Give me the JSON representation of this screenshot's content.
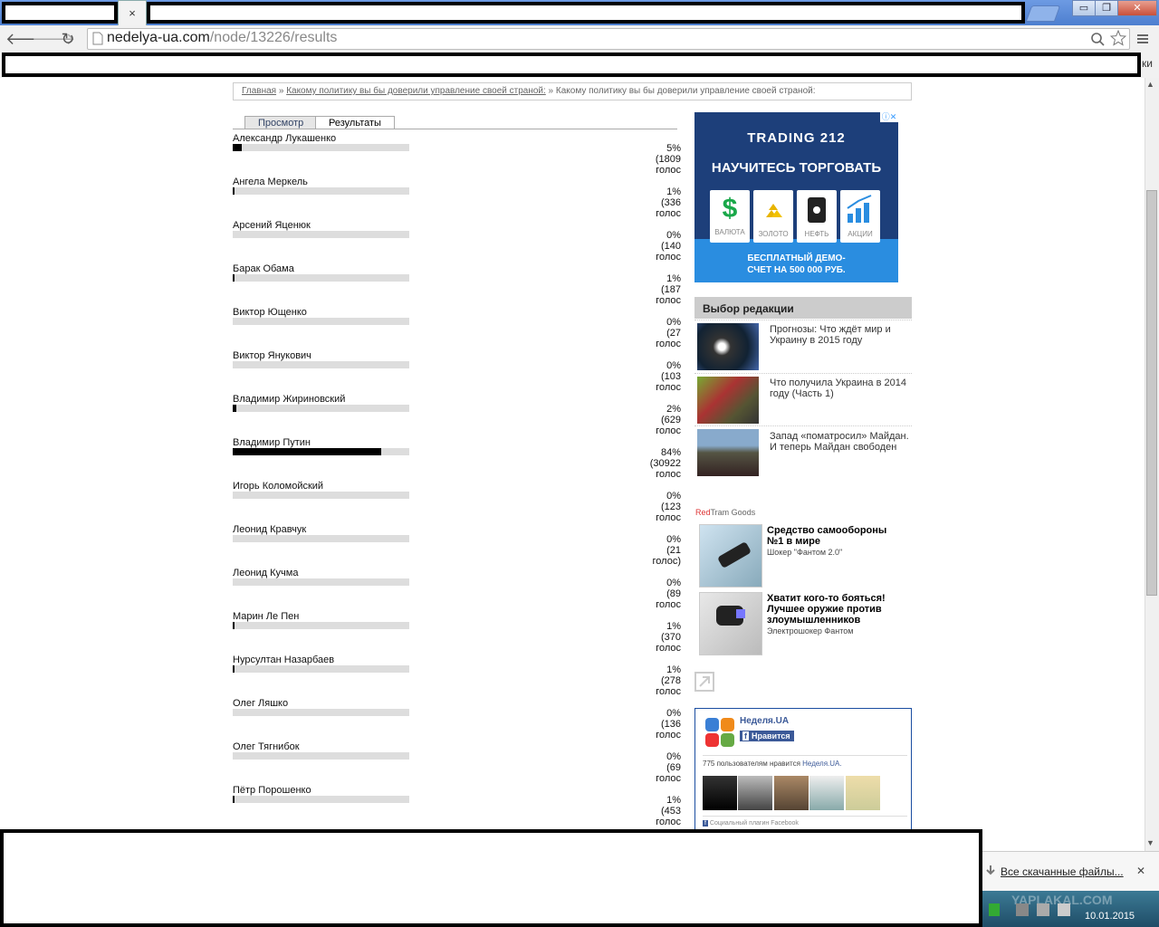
{
  "browser": {
    "tab_close_glyph": "×",
    "url_host": "nedelya-ua.com",
    "url_path": "/node/13226/results",
    "bookmarks_tail": "ки",
    "win_min": "▭",
    "win_restore": "❐",
    "win_close": "✕"
  },
  "breadcrumb": {
    "home": "Главная",
    "sep1": " » ",
    "parent": "Какому политику вы бы доверили управление своей страной:",
    "sep2": " » ",
    "current": "Какому политику вы бы доверили управление своей страной:"
  },
  "poll": {
    "tab_view": "Просмотр",
    "tab_results": "Результаты",
    "results": [
      {
        "name": "Александр Лукашенко",
        "pct": "5%",
        "votes": "(1809",
        "word": "голос",
        "share": 0.05
      },
      {
        "name": "Ангела Меркель",
        "pct": "1%",
        "votes": "(336",
        "word": "голос",
        "share": 0.01
      },
      {
        "name": "Арсений Яценюк",
        "pct": "0%",
        "votes": "(140",
        "word": "голос",
        "share": 0
      },
      {
        "name": "Барак Обама",
        "pct": "1%",
        "votes": "(187",
        "word": "голос",
        "share": 0.01
      },
      {
        "name": "Виктор Ющенко",
        "pct": "0%",
        "votes": "(27",
        "word": "голос",
        "share": 0
      },
      {
        "name": "Виктор Янукович",
        "pct": "0%",
        "votes": "(103",
        "word": "голос",
        "share": 0
      },
      {
        "name": "Владимир Жириновский",
        "pct": "2%",
        "votes": "(629",
        "word": "голос",
        "share": 0.02
      },
      {
        "name": "Владимир Путин",
        "pct": "84%",
        "votes": "(30922",
        "word": "голос",
        "share": 0.84
      },
      {
        "name": "Игорь Коломойский",
        "pct": "0%",
        "votes": "(123",
        "word": "голос",
        "share": 0
      },
      {
        "name": "Леонид Кравчук",
        "pct": "0%",
        "votes": "(21",
        "word": "голос)",
        "share": 0
      },
      {
        "name": "Леонид Кучма",
        "pct": "0%",
        "votes": "(89",
        "word": "голос",
        "share": 0
      },
      {
        "name": "Марин Ле Пен",
        "pct": "1%",
        "votes": "(370",
        "word": "голос",
        "share": 0.01
      },
      {
        "name": "Нурсултан Назарбаев",
        "pct": "1%",
        "votes": "(278",
        "word": "голос",
        "share": 0.01
      },
      {
        "name": "Олег Ляшко",
        "pct": "0%",
        "votes": "(136",
        "word": "голос",
        "share": 0
      },
      {
        "name": "Олег Тягнибок",
        "pct": "0%",
        "votes": "(69",
        "word": "голос",
        "share": 0
      },
      {
        "name": "Пётр Порошенко",
        "pct": "1%",
        "votes": "(453",
        "word": "голос",
        "share": 0.01
      }
    ]
  },
  "ad": {
    "brand": "TRADING 212",
    "headline": "НАУЧИТЕСЬ ТОРГОВАТЬ",
    "tiles": [
      "ВАЛЮТА",
      "ЗОЛОТО",
      "НЕФТЬ",
      "АКЦИИ"
    ],
    "cta_line1": "БЕСПЛАТНЫЙ ДЕМО-",
    "cta_line2": "СЧЕТ НА 500 000 РУБ.",
    "close_glyph": "ⓘ✕"
  },
  "editors": {
    "heading": "Выбор редакции",
    "items": [
      "Прогнозы: Что ждёт мир и Украину в 2015 году",
      "Что получила Украина в 2014 году (Часть 1)",
      "Запад «поматросил» Майдан. И теперь Майдан свободен"
    ]
  },
  "goods": {
    "label_red": "Red",
    "label_rest": "Tram Goods",
    "items": [
      {
        "title": "Средство самообороны №1 в мире",
        "sub": "Шокер \"Фантом 2.0\""
      },
      {
        "title": "Хватит кого-то бояться! Лучшее оружие против злоумышленников",
        "sub": "Электрошокер Фантом"
      }
    ]
  },
  "facebook": {
    "page": "Неделя.UA",
    "like": "Нравится",
    "count_text": "775 пользователям нравится",
    "count_link": "Неделя.UA.",
    "plugin": "Социальный плагин Facebook"
  },
  "downloads": {
    "label": "Все скачанные файлы...",
    "close": "✕"
  },
  "taskbar": {
    "date": "10.01.2015",
    "watermark": "YAPLAKAL.COM"
  },
  "colors": {
    "ad_dark": "#1d3f7a",
    "ad_blue": "#2a8de0",
    "fb_blue": "#3b5998",
    "goods_red": "#d33"
  }
}
